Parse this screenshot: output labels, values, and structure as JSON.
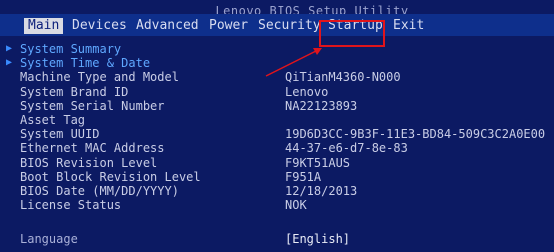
{
  "window_title": "Lenovo BIOS Setup Utility",
  "tabs": [
    {
      "label": "Main"
    },
    {
      "label": "Devices"
    },
    {
      "label": "Advanced"
    },
    {
      "label": "Power"
    },
    {
      "label": "Security"
    },
    {
      "label": "Startup"
    },
    {
      "label": "Exit"
    }
  ],
  "submenus": [
    {
      "label": "System Summary"
    },
    {
      "label": "System Time & Date"
    }
  ],
  "info": [
    {
      "label": "Machine Type and Model",
      "value": "QiTianM4360-N000"
    },
    {
      "label": "System Brand ID",
      "value": "Lenovo"
    },
    {
      "label": "System Serial Number",
      "value": "NA22123893"
    },
    {
      "label": "Asset Tag",
      "value": ""
    },
    {
      "label": "System UUID",
      "value": "19D6D3CC-9B3F-11E3-BD84-509C3C2A0E00"
    },
    {
      "label": "Ethernet MAC Address",
      "value": "44-37-e6-d7-8e-83"
    },
    {
      "label": "BIOS Revision Level",
      "value": "F9KT51AUS"
    },
    {
      "label": "Boot Block Revision Level",
      "value": "F951A"
    },
    {
      "label": "BIOS Date (MM/DD/YYYY)",
      "value": "12/18/2013"
    },
    {
      "label": "License Status",
      "value": "NOK"
    }
  ],
  "language": {
    "label": "Language",
    "value": "[English]"
  },
  "colors": {
    "background": "#0c1a63",
    "active_tab": "#d9dbe4",
    "highlight": "#e0141b",
    "submenu": "#5fa8ff"
  }
}
